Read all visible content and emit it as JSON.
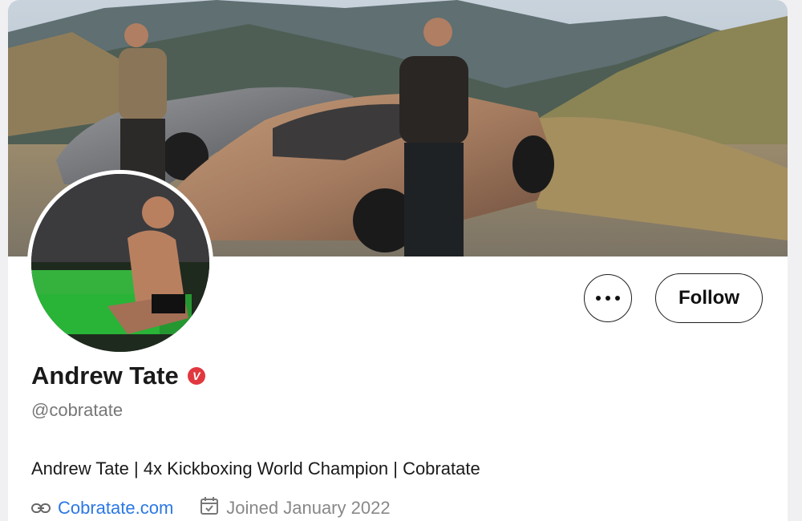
{
  "profile": {
    "name": "Andrew Tate",
    "verified_mark": "V",
    "handle": "@cobratate",
    "bio": "Andrew Tate | 4x Kickboxing World Champion | Cobratate",
    "website": "Cobratate.com",
    "joined": "Joined January 2022"
  },
  "actions": {
    "follow_label": "Follow"
  },
  "icons": {
    "more": "more-horizontal-icon",
    "link": "link-icon",
    "calendar": "calendar-icon"
  },
  "colors": {
    "verified": "#e0383e",
    "link": "#2b78e4",
    "muted": "#888888"
  }
}
